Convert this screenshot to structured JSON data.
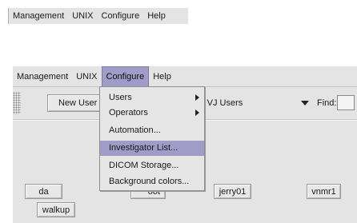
{
  "menubar_top": {
    "items": [
      "Management",
      "UNIX",
      "Configure",
      "Help"
    ]
  },
  "menubar_main": {
    "items": [
      "Management",
      "UNIX",
      "Configure",
      "Help"
    ],
    "open_item": "Configure"
  },
  "toolbar": {
    "new_user_label": "New User",
    "filter_value": "v all VJ Users",
    "find_label": "Find:",
    "find_value": ""
  },
  "configure_menu": {
    "items": [
      {
        "label": "Users",
        "submenu": true
      },
      {
        "label": "Operators",
        "submenu": true
      },
      {
        "label": "Automation...",
        "submenu": false
      },
      {
        "label": "Investigator List...",
        "submenu": false,
        "highlighted": true
      },
      {
        "label": "DICOM Storage...",
        "submenu": false
      },
      {
        "label": "Background colors...",
        "submenu": false
      }
    ]
  },
  "users": {
    "buttons": [
      "da",
      "walkup",
      "jerry01",
      "vnmr1"
    ],
    "partial_label": "oot"
  },
  "colors": {
    "menu_highlight": "#a09bc7",
    "window_bg": "#e4e4e4"
  }
}
